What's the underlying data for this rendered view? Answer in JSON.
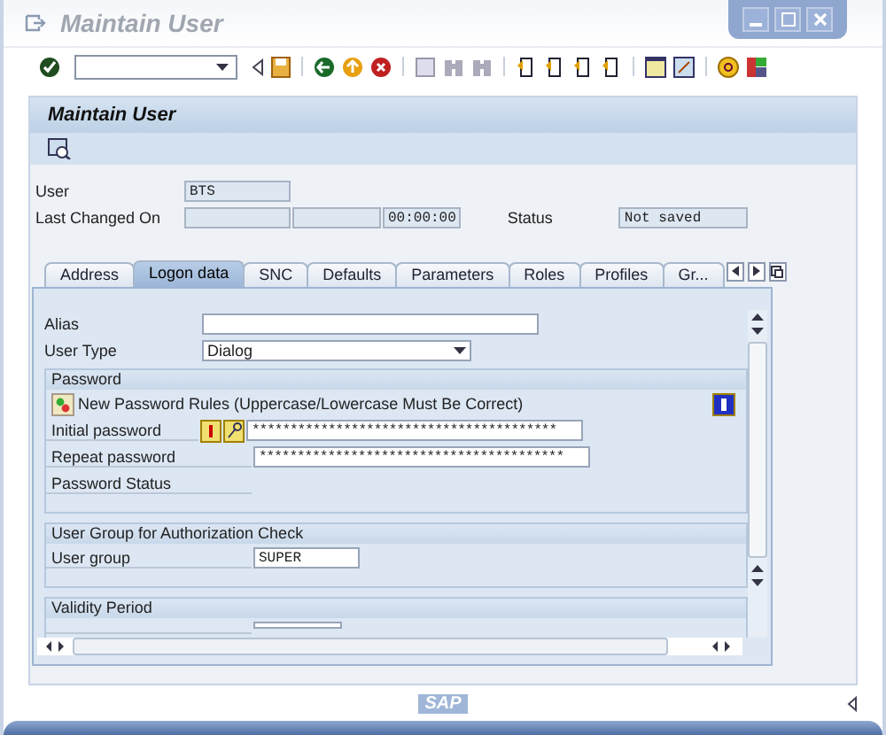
{
  "window": {
    "title": "Maintain User"
  },
  "screen": {
    "title": "Maintain User"
  },
  "user": {
    "label": "User",
    "value": "BTS"
  },
  "last_changed": {
    "label": "Last Changed On",
    "time": "00:00:00"
  },
  "status": {
    "label": "Status",
    "value": "Not saved"
  },
  "tabs": [
    {
      "label": "Address",
      "selected": false
    },
    {
      "label": "Logon data",
      "selected": true
    },
    {
      "label": "SNC",
      "selected": false
    },
    {
      "label": "Defaults",
      "selected": false
    },
    {
      "label": "Parameters",
      "selected": false
    },
    {
      "label": "Roles",
      "selected": false
    },
    {
      "label": "Profiles",
      "selected": false
    },
    {
      "label": "Gr...",
      "selected": false
    }
  ],
  "alias": {
    "label": "Alias"
  },
  "user_type": {
    "label": "User Type",
    "value": "Dialog"
  },
  "password": {
    "title": "Password",
    "rules": "New Password Rules (Uppercase/Lowercase Must Be Correct)",
    "initial_label": "Initial password",
    "initial_value": "****************************************",
    "repeat_label": "Repeat password",
    "repeat_value": "****************************************",
    "status_label": "Password Status"
  },
  "user_group": {
    "title": "User Group for Authorization Check",
    "label": "User group",
    "value": "SUPER"
  },
  "validity": {
    "title": "Validity Period"
  },
  "logo": "SAP"
}
